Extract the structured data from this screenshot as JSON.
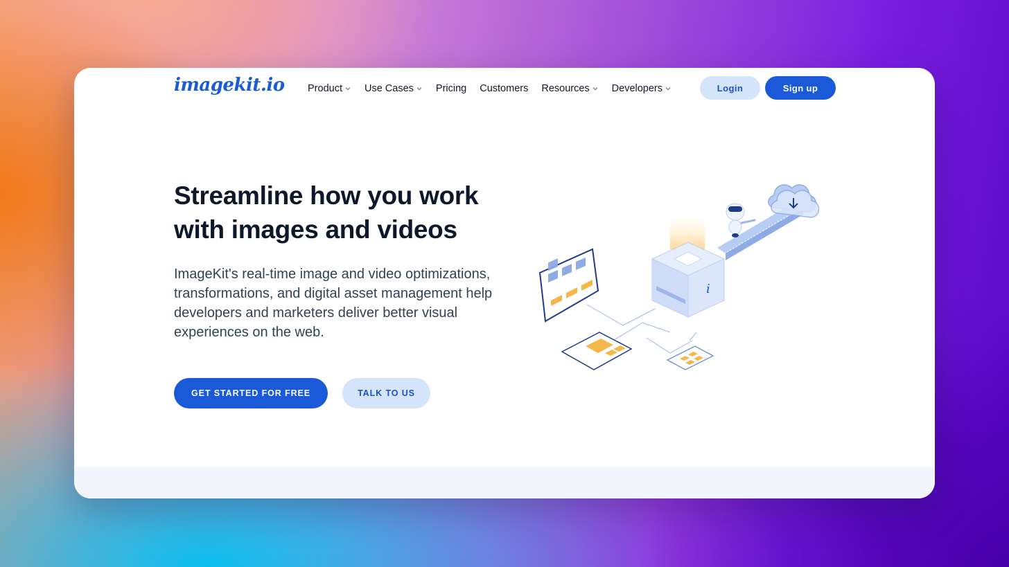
{
  "brand": {
    "logo_text": "imagekit.io",
    "accent": "#1a5ad8",
    "accent_light": "#d4e4fb"
  },
  "nav": {
    "items": [
      {
        "label": "Product",
        "has_dropdown": true
      },
      {
        "label": "Use Cases",
        "has_dropdown": true
      },
      {
        "label": "Pricing",
        "has_dropdown": false
      },
      {
        "label": "Customers",
        "has_dropdown": false
      },
      {
        "label": "Resources",
        "has_dropdown": true
      },
      {
        "label": "Developers",
        "has_dropdown": true
      }
    ],
    "login_label": "Login",
    "signup_label": "Sign up"
  },
  "hero": {
    "title_line1": "Streamline how you work",
    "title_line2": "with images and videos",
    "description": "ImageKit's real-time image and video optimizations, transformations, and digital asset management help developers and marketers deliver better visual experiences on the web.",
    "primary_cta": "GET STARTED FOR FREE",
    "secondary_cta": "TALK TO US",
    "illustration_icon": "imagekit-processing-cube-illustration",
    "cube_letter": "i"
  }
}
